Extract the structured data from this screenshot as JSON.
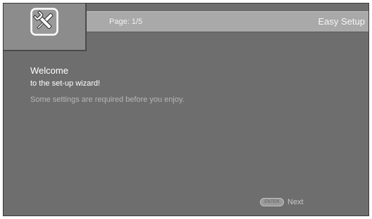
{
  "header": {
    "page_indicator": "Page: 1/5",
    "title": "Easy Setup",
    "icon": "wrench-setup-icon"
  },
  "main": {
    "welcome": "Welcome",
    "subtitle": "to the set-up wizard!",
    "note": "Some settings are required before you enjoy."
  },
  "footer": {
    "enter_key_label": "ENTER",
    "next_label": "Next"
  },
  "colors": {
    "background": "#6e6e6e",
    "header_bar": "#a9a9a9",
    "icon_box": "#8c8c8c",
    "note_text": "#b7b7b7"
  }
}
